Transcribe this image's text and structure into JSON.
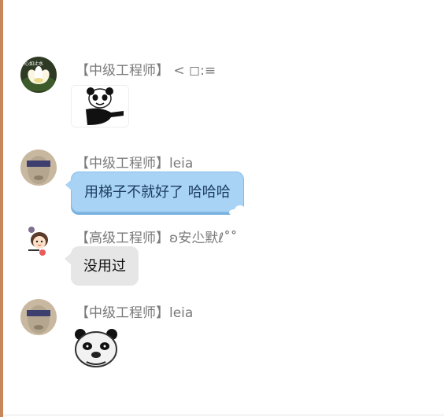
{
  "messages": [
    {
      "sender": "【中级工程师】 < ◻:≡",
      "type": "sticker",
      "avatar_icon": "lotus-avatar",
      "sticker_icon": "panda-pointing-sticker"
    },
    {
      "sender": "【中级工程师】leia",
      "type": "text",
      "text": "用梯子不就好了 哈哈哈",
      "style": "blue",
      "avatar_icon": "statue-avatar"
    },
    {
      "sender": "【高级工程师】ʚ安尐默ℓ˚̊˚̊",
      "type": "text",
      "text": "没用过",
      "style": "gray",
      "avatar_icon": "cartoon-girl-avatar"
    },
    {
      "sender": "【中级工程师】leia",
      "type": "sticker",
      "avatar_icon": "statue-avatar",
      "sticker_icon": "panda-face-sticker"
    }
  ],
  "colors": {
    "bubble_blue": "#a8d3f5",
    "bubble_gray": "#e6e6e6",
    "sender_text": "#7a7a7a",
    "left_accent": "#c8875a"
  }
}
